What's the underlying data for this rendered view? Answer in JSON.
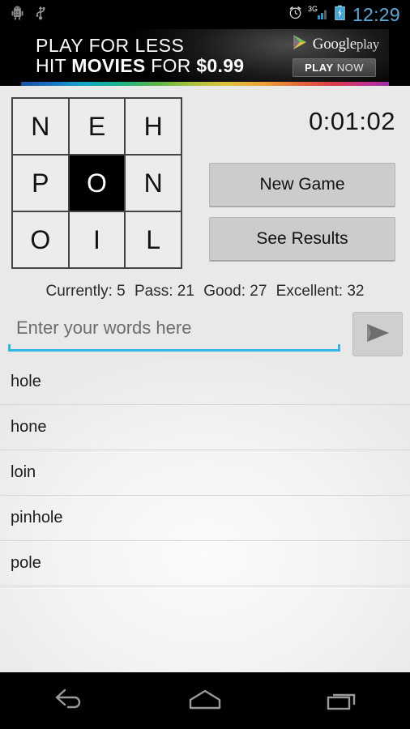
{
  "status_bar": {
    "left_icons": [
      "android-debug-icon",
      "usb-icon"
    ],
    "right_icons": [
      "alarm-clock-icon",
      "signal-3g-icon",
      "battery-charging-icon"
    ],
    "network_label": "3G",
    "time": "12:29"
  },
  "ad": {
    "line1": "PLAY FOR LESS",
    "line2_a": "HIT ",
    "line2_b": "MOVIES",
    "line2_c": " FOR ",
    "line2_d": "$0.99",
    "brand_main": "Google",
    "brand_light": "play",
    "cta_bold": "PLAY",
    "cta_rest": " NOW"
  },
  "game": {
    "grid": [
      {
        "letter": "N",
        "selected": false
      },
      {
        "letter": "E",
        "selected": false
      },
      {
        "letter": "H",
        "selected": false
      },
      {
        "letter": "P",
        "selected": false
      },
      {
        "letter": "O",
        "selected": true
      },
      {
        "letter": "N",
        "selected": false
      },
      {
        "letter": "O",
        "selected": false
      },
      {
        "letter": "I",
        "selected": false
      },
      {
        "letter": "L",
        "selected": false
      }
    ],
    "timer": "0:01:02",
    "new_game_label": "New Game",
    "see_results_label": "See Results",
    "score": {
      "currently": "Currently: 5",
      "pass": "Pass: 21",
      "good": "Good: 27",
      "excellent": "Excellent: 32"
    },
    "input_placeholder": "Enter your words here",
    "input_value": "",
    "send_icon": "send-arrow-icon",
    "found_words": [
      "hole",
      "hone",
      "loin",
      "pinhole",
      "pole"
    ]
  },
  "nav_bar": {
    "back_label": "back-icon",
    "home_label": "home-icon",
    "recents_label": "recents-icon"
  },
  "colors": {
    "accent_blue": "#33b5e5",
    "clock_blue": "#5aa9d6",
    "app_background": "#e9e9e9",
    "button_gray": "#cccccc",
    "selected_cell": "#000000"
  }
}
